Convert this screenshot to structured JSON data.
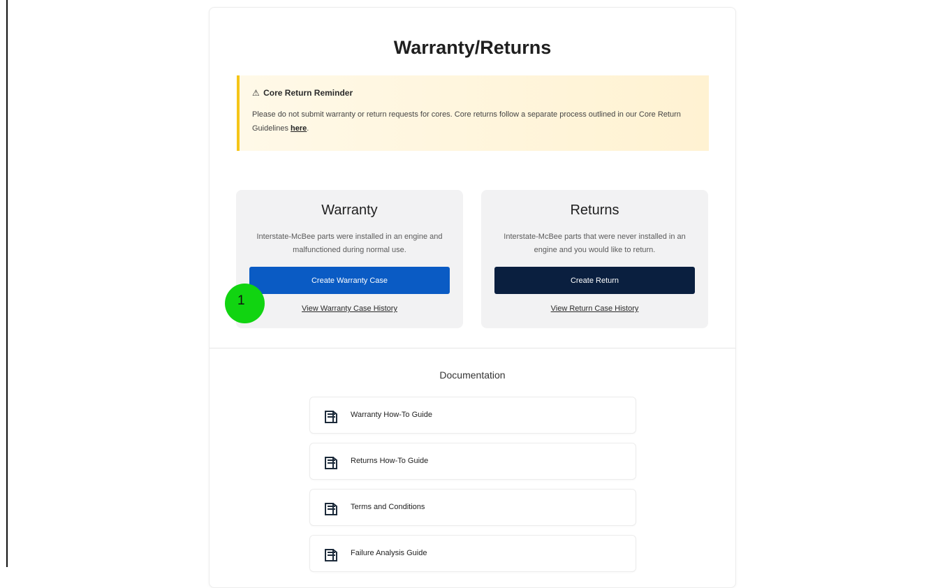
{
  "page": {
    "title": "Warranty/Returns"
  },
  "alert": {
    "icon": "warning-icon",
    "icon_glyph": "⚠",
    "title": "Core Return Reminder",
    "body": "Please do not submit warranty or return requests for cores. Core returns follow a separate process outlined in our Core Return Guidelines ",
    "link_label": "here",
    "body_end": ".",
    "accent_color": "#f5c518"
  },
  "warranty": {
    "title": "Warranty",
    "description": "Interstate-McBee parts were installed in an engine and malfunctioned during normal use.",
    "button_label": "Create Warranty Case",
    "link_label": "View Warranty Case History",
    "button_color": "#0a5bc4"
  },
  "returns": {
    "title": "Returns",
    "description": "Interstate-McBee parts that were never installed in an engine and you would like to return.",
    "button_label": "Create Return",
    "link_label": "View Return Case History",
    "button_color": "#0a1f3f"
  },
  "annotation": {
    "marker_label": "1",
    "marker_color": "#11d411"
  },
  "documentation": {
    "heading": "Documentation",
    "items": [
      {
        "label": "Warranty How-To Guide",
        "icon": "document-icon"
      },
      {
        "label": "Returns How-To Guide",
        "icon": "document-icon"
      },
      {
        "label": "Terms and Conditions",
        "icon": "document-icon"
      },
      {
        "label": "Failure Analysis Guide",
        "icon": "document-icon"
      }
    ]
  }
}
